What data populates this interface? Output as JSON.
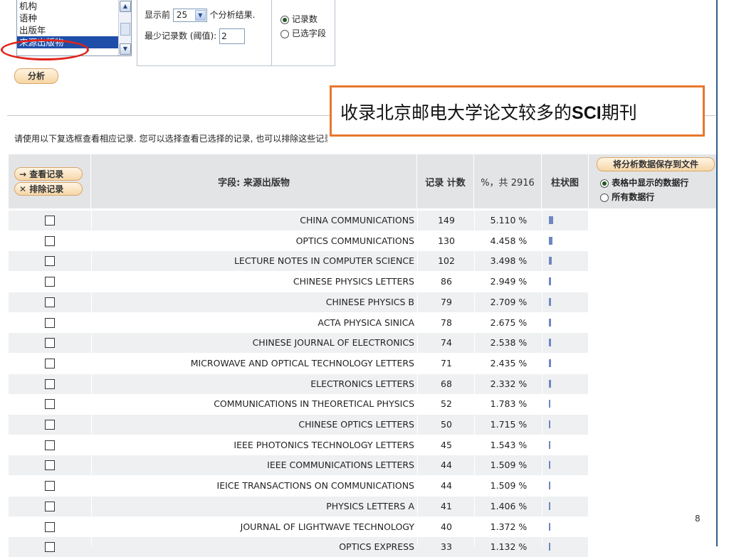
{
  "field_list": {
    "options": [
      "机构",
      "语种",
      "出版年",
      "来源出版物"
    ],
    "selected": "来源出版物"
  },
  "controls": {
    "show_prefix": "显示前",
    "show_value": "25",
    "show_suffix": "个分析结果.",
    "min_records_label": "最少记录数 (阈值):",
    "min_records_value": "2",
    "radio_record_count": "记录数",
    "radio_selected_field": "已选字段",
    "analyze_button": "分析"
  },
  "annotation": {
    "prefix": "收录北京邮电大学论文较多的",
    "bold": "SCI",
    "suffix": "期刊"
  },
  "info_text": "请使用以下复选框查看相应记录. 您可以选择查看已选择的记录, 也可以排除这些记录(并查看其他记录).",
  "table": {
    "view_records_button": "→ 查看记录",
    "exclude_records_button": "✕ 排除记录",
    "col_field": "字段: 来源出版物",
    "col_count": "记录 计数",
    "col_percent": "%，共 2916",
    "col_bar": "柱状图",
    "save_button": "将分析数据保存到文件",
    "save_option_shown": "表格中显示的数据行",
    "save_option_all": "所有数据行",
    "rows": [
      {
        "name": "CHINA COMMUNICATIONS",
        "count": "149",
        "percent": "5.110 %",
        "value": 5.11
      },
      {
        "name": "OPTICS COMMUNICATIONS",
        "count": "130",
        "percent": "4.458 %",
        "value": 4.458
      },
      {
        "name": "LECTURE NOTES IN COMPUTER SCIENCE",
        "count": "102",
        "percent": "3.498 %",
        "value": 3.498
      },
      {
        "name": "CHINESE PHYSICS LETTERS",
        "count": "86",
        "percent": "2.949 %",
        "value": 2.949
      },
      {
        "name": "CHINESE PHYSICS B",
        "count": "79",
        "percent": "2.709 %",
        "value": 2.709
      },
      {
        "name": "ACTA PHYSICA SINICA",
        "count": "78",
        "percent": "2.675 %",
        "value": 2.675
      },
      {
        "name": "CHINESE JOURNAL OF ELECTRONICS",
        "count": "74",
        "percent": "2.538 %",
        "value": 2.538
      },
      {
        "name": "MICROWAVE AND OPTICAL TECHNOLOGY LETTERS",
        "count": "71",
        "percent": "2.435 %",
        "value": 2.435
      },
      {
        "name": "ELECTRONICS LETTERS",
        "count": "68",
        "percent": "2.332 %",
        "value": 2.332
      },
      {
        "name": "COMMUNICATIONS IN THEORETICAL PHYSICS",
        "count": "52",
        "percent": "1.783 %",
        "value": 1.783
      },
      {
        "name": "CHINESE OPTICS LETTERS",
        "count": "50",
        "percent": "1.715 %",
        "value": 1.715
      },
      {
        "name": "IEEE PHOTONICS TECHNOLOGY LETTERS",
        "count": "45",
        "percent": "1.543 %",
        "value": 1.543
      },
      {
        "name": "IEEE COMMUNICATIONS LETTERS",
        "count": "44",
        "percent": "1.509 %",
        "value": 1.509
      },
      {
        "name": "IEICE TRANSACTIONS ON COMMUNICATIONS",
        "count": "44",
        "percent": "1.509 %",
        "value": 1.509
      },
      {
        "name": "PHYSICS LETTERS A",
        "count": "41",
        "percent": "1.406 %",
        "value": 1.406
      },
      {
        "name": "JOURNAL OF LIGHTWAVE TECHNOLOGY",
        "count": "40",
        "percent": "1.372 %",
        "value": 1.372
      },
      {
        "name": "OPTICS EXPRESS",
        "count": "33",
        "percent": "1.132 %",
        "value": 1.132
      }
    ]
  },
  "page_number": "8",
  "colors": {
    "selection": "#1f4ea8",
    "bar": "#6f86c2",
    "annotation_border": "#e8772e",
    "ellipse": "#e2231a"
  }
}
